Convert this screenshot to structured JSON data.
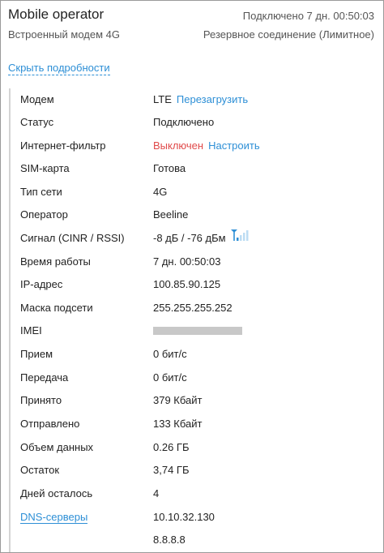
{
  "header": {
    "title": "Mobile operator",
    "subtitle": "Встроенный модем 4G",
    "status": "Подключено 7 дн. 00:50:03",
    "connection_type": "Резервное соединение (Лимитное)"
  },
  "toggle_label": "Скрыть подробности",
  "rows": {
    "modem": {
      "label": "Модем",
      "value": "LTE",
      "action": "Перезагрузить"
    },
    "status": {
      "label": "Статус",
      "value": "Подключено"
    },
    "filter": {
      "label": "Интернет-фильтр",
      "value": "Выключен",
      "action": "Настроить"
    },
    "sim": {
      "label": "SIM-карта",
      "value": "Готова"
    },
    "net_type": {
      "label": "Тип сети",
      "value": "4G"
    },
    "operator": {
      "label": "Оператор",
      "value": "Beeline"
    },
    "signal": {
      "label": "Сигнал (CINR / RSSI)",
      "value": "-8 дБ / -76 дБм",
      "bars": 1,
      "bars_total": 4
    },
    "uptime": {
      "label": "Время работы",
      "value": "7 дн. 00:50:03"
    },
    "ip": {
      "label": "IP-адрес",
      "value": "100.85.90.125"
    },
    "mask": {
      "label": "Маска подсети",
      "value": "255.255.255.252"
    },
    "imei": {
      "label": "IMEI"
    },
    "rx": {
      "label": "Прием",
      "value": "0 бит/с"
    },
    "tx": {
      "label": "Передача",
      "value": "0 бит/с"
    },
    "received": {
      "label": "Принято",
      "value": "379 Кбайт"
    },
    "sent": {
      "label": "Отправлено",
      "value": "133 Кбайт"
    },
    "data_volume": {
      "label": "Объем данных",
      "value": "0.26 ГБ"
    },
    "remaining": {
      "label": "Остаток",
      "value": "3,74 ГБ"
    },
    "days_left": {
      "label": "Дней осталось",
      "value": "4"
    },
    "dns": {
      "label": "DNS-серверы",
      "value1": "10.10.32.130",
      "value2": "8.8.8.8"
    }
  },
  "colors": {
    "link": "#2d8fd6",
    "ok": "#2c9a3a",
    "off": "#e04a4a"
  },
  "icons": {
    "signal": "signal-strength-icon"
  }
}
